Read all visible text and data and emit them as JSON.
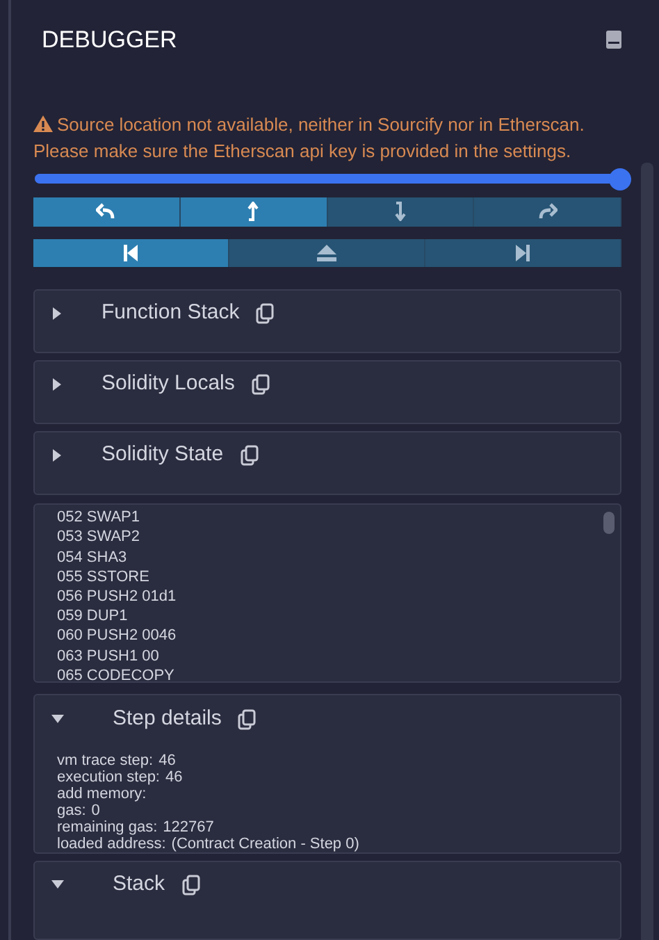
{
  "title": "DEBUGGER",
  "warning": {
    "lines": [
      "Source location not available, neither in Sourcify nor in Etherscan.",
      "Please make sure the Etherscan api key is provided in the settings."
    ]
  },
  "slider": {
    "level": 1
  },
  "step_buttons": [
    {
      "kind": "step-back",
      "disabled": false
    },
    {
      "kind": "step-into",
      "disabled": false
    },
    {
      "kind": "step-out",
      "disabled": true
    },
    {
      "kind": "step-over",
      "disabled": true
    }
  ],
  "jump_buttons": [
    {
      "kind": "jump-previous",
      "disabled": false
    },
    {
      "kind": "jump-out",
      "disabled": true
    },
    {
      "kind": "jump-next",
      "disabled": true
    }
  ],
  "sections": [
    {
      "title": "Function Stack",
      "expanded": false
    },
    {
      "title": "Solidity Locals",
      "expanded": false
    },
    {
      "title": "Solidity State",
      "expanded": false
    }
  ],
  "opcodes": [
    "052 SWAP1",
    "053 SWAP2",
    "054 SHA3",
    "055 SSTORE",
    "056 PUSH2 01d1",
    "059 DUP1",
    "060 PUSH2 0046",
    "063 PUSH1 00",
    "065 CODECOPY"
  ],
  "step_details": {
    "title": "Step details",
    "expanded": true,
    "rows": [
      {
        "label": "vm trace step:",
        "value": "46"
      },
      {
        "label": "execution step:",
        "value": "46"
      },
      {
        "label": "add memory:"
      },
      {
        "label": "gas:",
        "value": "0"
      },
      {
        "label": "remaining gas:",
        "value": "122767"
      },
      {
        "label": "loaded address:",
        "value": "(Contract Creation - Step 0)"
      }
    ]
  },
  "stack": {
    "title": "Stack",
    "expanded": true
  }
}
